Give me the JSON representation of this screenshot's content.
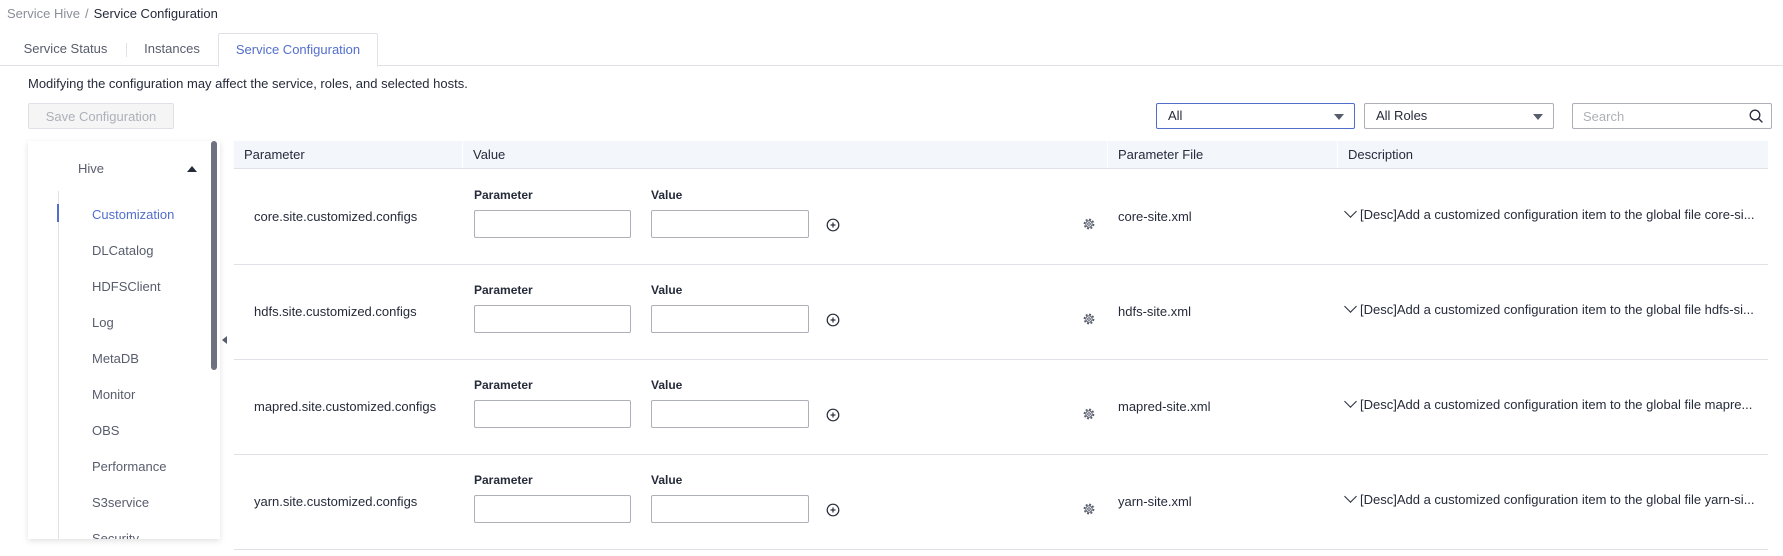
{
  "breadcrumb": {
    "parent": "Service Hive",
    "separator": "/",
    "current": "Service Configuration"
  },
  "tabs": [
    {
      "label": "Service Status"
    },
    {
      "label": "Instances"
    },
    {
      "label": "Service Configuration",
      "active": true
    }
  ],
  "notice": "Modifying the configuration may affect the service, roles, and selected hosts.",
  "toolbar": {
    "save_label": "Save Configuration",
    "filter_value": "All",
    "roles_value": "All Roles",
    "search_placeholder": "Search"
  },
  "sidebar": {
    "group": "Hive",
    "items": [
      {
        "label": "Customization",
        "active": true
      },
      {
        "label": "DLCatalog"
      },
      {
        "label": "HDFSClient"
      },
      {
        "label": "Log"
      },
      {
        "label": "MetaDB"
      },
      {
        "label": "Monitor"
      },
      {
        "label": "OBS"
      },
      {
        "label": "Performance"
      },
      {
        "label": "S3service"
      },
      {
        "label": "Security"
      }
    ]
  },
  "table": {
    "headers": {
      "parameter": "Parameter",
      "value": "Value",
      "file": "Parameter File",
      "description": "Description"
    },
    "sub_labels": {
      "parameter": "Parameter",
      "value": "Value"
    },
    "rows": [
      {
        "name": "core.site.customized.configs",
        "file": "core-site.xml",
        "desc": "[Desc]Add a customized configuration item to the global file core-si..."
      },
      {
        "name": "hdfs.site.customized.configs",
        "file": "hdfs-site.xml",
        "desc": "[Desc]Add a customized configuration item to the global file hdfs-si..."
      },
      {
        "name": "mapred.site.customized.configs",
        "file": "mapred-site.xml",
        "desc": "[Desc]Add a customized configuration item to the global file mapre..."
      },
      {
        "name": "yarn.site.customized.configs",
        "file": "yarn-site.xml",
        "desc": "[Desc]Add a customized configuration item to the global file yarn-si..."
      }
    ]
  },
  "colors": {
    "accent": "#526ecc",
    "border": "#dfe1e6",
    "header_bg": "#f3f6fb"
  }
}
